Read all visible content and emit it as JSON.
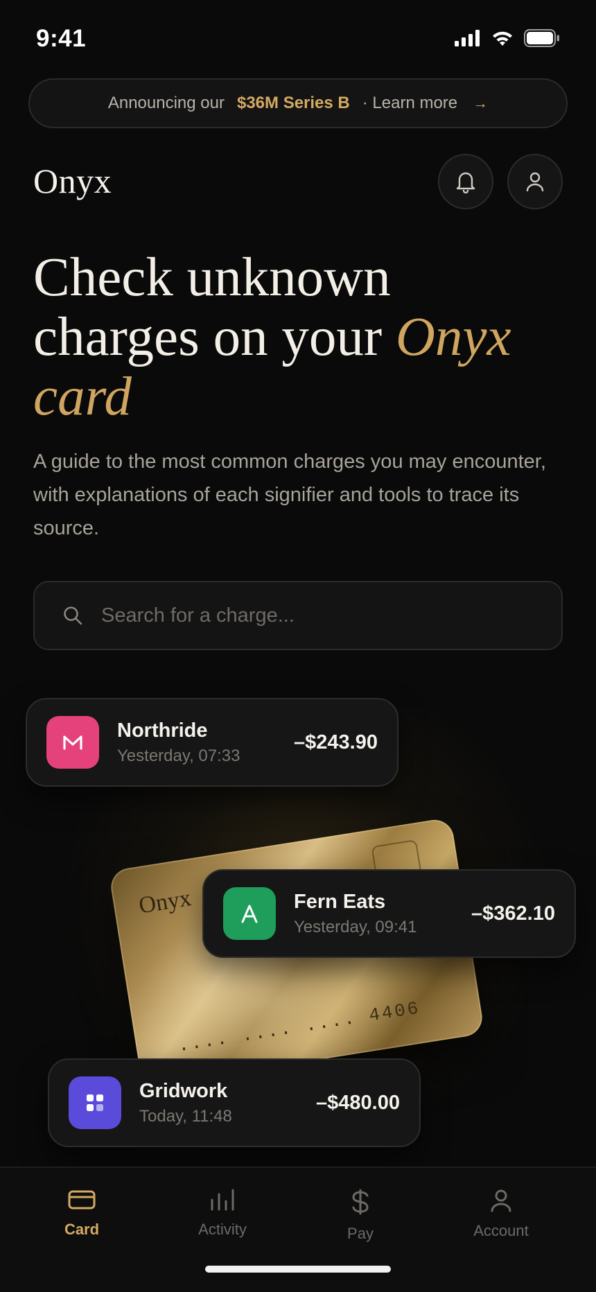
{
  "status_bar": {
    "time": "9:41"
  },
  "announcement": {
    "prefix": "Announcing our",
    "highlight": "$36M Series B",
    "suffix": "· Learn more",
    "arrow": "→"
  },
  "header": {
    "logo": "Onyx",
    "bell_icon": "bell-icon",
    "profile_icon": "user-icon"
  },
  "hero": {
    "headline_line1": "Check unknown",
    "headline_line2": "charges on your",
    "headline_accent1": "Onyx",
    "headline_accent2": "card",
    "description": "A guide to the most common charges you may encounter, with explanations of each signifier and tools to trace its source."
  },
  "search": {
    "placeholder": "Search for a charge...",
    "value": ""
  },
  "card": {
    "brand": "Onyx",
    "number": ".... .... .... 4406"
  },
  "transactions": [
    {
      "name": "Northride",
      "time": "Yesterday, 07:33",
      "amount": "–$243.90",
      "icon": "m-logo-icon",
      "color": "#e5427b"
    },
    {
      "name": "Fern Eats",
      "time": "Yesterday, 09:41",
      "amount": "–$362.10",
      "icon": "a-logo-icon",
      "color": "#1e9e5a"
    },
    {
      "name": "Gridwork",
      "time": "Today, 11:48",
      "amount": "–$480.00",
      "icon": "grid-logo-icon",
      "color": "#5b4bdb"
    }
  ],
  "nav": {
    "items": [
      {
        "label": "Card",
        "icon": "card-icon",
        "active": true
      },
      {
        "label": "Activity",
        "icon": "bar-chart-icon",
        "active": false
      },
      {
        "label": "Pay",
        "icon": "dollar-icon",
        "active": false
      },
      {
        "label": "Account",
        "icon": "user-icon",
        "active": false
      }
    ]
  },
  "colors": {
    "accent": "#d4aa62",
    "background": "#0a0a0a",
    "surface": "#161616"
  }
}
